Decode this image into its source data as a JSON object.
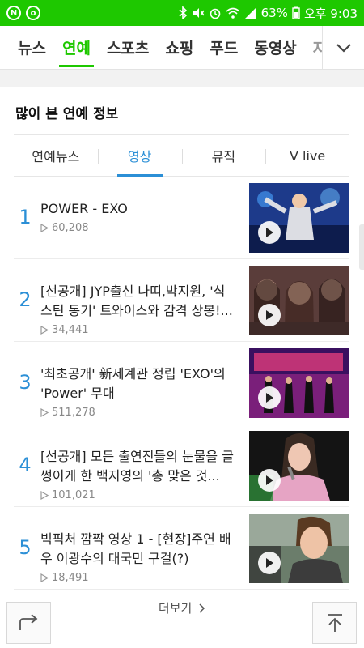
{
  "status_bar": {
    "left_icons": [
      "naver-app-icon",
      "notification-icon"
    ],
    "battery": "63%",
    "time_label": "오후 9:03",
    "colors": {
      "background": "#1ec800"
    }
  },
  "nav": {
    "tabs": [
      {
        "label": "뉴스",
        "active": false
      },
      {
        "label": "연예",
        "active": true
      },
      {
        "label": "스포츠",
        "active": false
      },
      {
        "label": "쇼핑",
        "active": false
      },
      {
        "label": "푸드",
        "active": false
      },
      {
        "label": "동영상",
        "active": false
      },
      {
        "label": "자",
        "active": false
      }
    ],
    "expand_icon": "chevron-down-icon"
  },
  "section": {
    "title": "많이 본 연예 정보",
    "subtabs": [
      {
        "label": "연예뉴스",
        "active": false
      },
      {
        "label": "영상",
        "active": true
      },
      {
        "label": "뮤직",
        "active": false
      },
      {
        "label": "V live",
        "active": false
      }
    ],
    "items": [
      {
        "rank": "1",
        "title": "POWER - EXO",
        "views": "60,208"
      },
      {
        "rank": "2",
        "title": "[선공개] JYP출신 나띠,박지원, '식스틴 동기' 트와이스와 감격 상봉!...",
        "views": "34,441"
      },
      {
        "rank": "3",
        "title": "'최초공개' 新세계관 정립 'EXO'의 'Power' 무대",
        "views": "511,278"
      },
      {
        "rank": "4",
        "title": "[선공개] 모든 출연진들의 눈물을 글썽이게 한 백지영의 '총 맞은 것...",
        "views": "101,021"
      },
      {
        "rank": "5",
        "title": "빅픽처 깜짝 영상 1 - [현장]주연 배우 이광수의 대국민 구걸(?)",
        "views": "18,491"
      }
    ],
    "more_label": "더보기",
    "accent_color": "#2b8fd6"
  },
  "floating": {
    "share_icon": "share-icon",
    "top_icon": "arrow-up-icon"
  }
}
